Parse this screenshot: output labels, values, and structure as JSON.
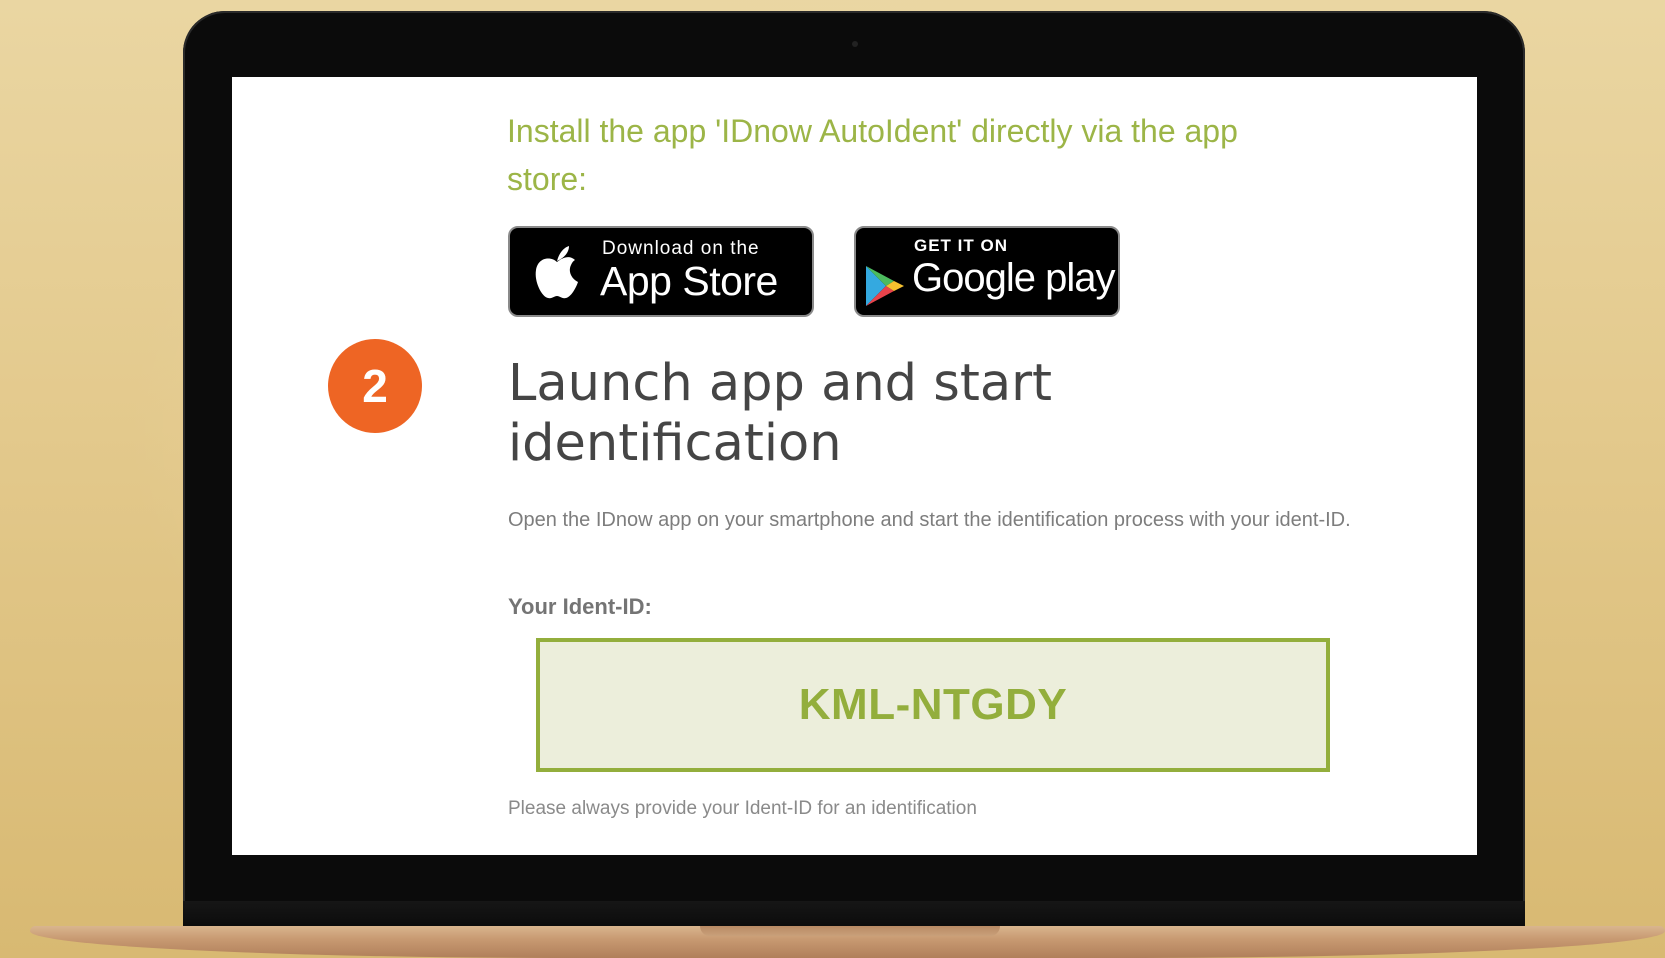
{
  "instructions": {
    "install_text": "Install the app 'IDnow AutoIdent' directly via the app store:"
  },
  "store_badges": {
    "app_store": {
      "small_text": "Download on the",
      "big_text": "App Store",
      "icon": "apple-logo-icon"
    },
    "google_play": {
      "small_text": "GET IT ON",
      "big_text": "Google play",
      "icon": "google-play-triangle-icon"
    }
  },
  "step": {
    "number": "2",
    "heading": "Launch app and start identification",
    "description": "Open the IDnow app on your smartphone and start the identification process with your ident-ID."
  },
  "ident": {
    "label": "Your Ident-ID:",
    "value": "KML-NTGDY",
    "footnote": "Please always provide your Ident-ID for an identification"
  },
  "colors": {
    "accent_green": "#93ae3c",
    "install_text_green": "#9cb547",
    "step_orange": "#ee6524",
    "ident_box_bg": "#eceedb",
    "page_background": "#e3c98c"
  }
}
